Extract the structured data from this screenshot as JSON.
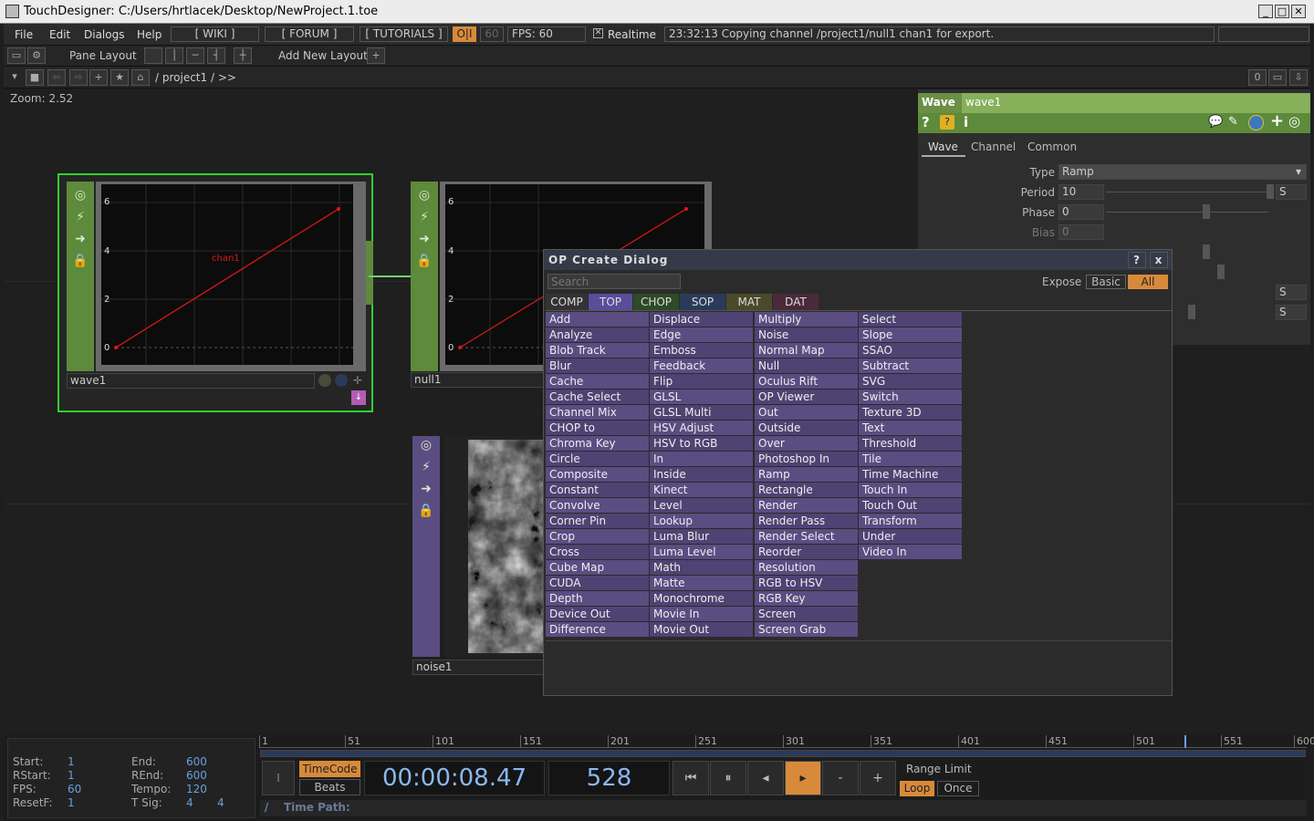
{
  "window": {
    "title": "TouchDesigner: C:/Users/hrtlacek/Desktop/NewProject.1.toe"
  },
  "menu": {
    "file": "File",
    "edit": "Edit",
    "dialogs": "Dialogs",
    "help": "Help",
    "wiki": "[ WIKI ]",
    "forum": "[ FORUM ]",
    "tutorials": "[ TUTORIALS ]",
    "oi": "O|I",
    "fps_cap": "60",
    "fps": "FPS:  60",
    "realtime": "Realtime",
    "status": "23:32:13 Copying channel /project1/null1 chan1 for export."
  },
  "toolbar": {
    "pane_layout": "Pane Layout",
    "add_layout": "Add New Layout",
    "path": "/ project1 / >>",
    "zero": "0"
  },
  "network": {
    "zoom": "Zoom: 2.52",
    "wave": {
      "name": "wave1",
      "chan": "chan1",
      "ticks": [
        "6",
        "4",
        "2",
        "0"
      ]
    },
    "null": {
      "name": "null1",
      "ticks": [
        "6",
        "4",
        "2",
        "0"
      ]
    },
    "noise": {
      "name": "noise1"
    }
  },
  "params": {
    "op_type": "Wave",
    "op_name": "wave1",
    "tabs": [
      "Wave",
      "Channel",
      "Common"
    ],
    "type_label": "Type",
    "type_value": "Ramp",
    "period_label": "Period",
    "period_value": "10",
    "phase_label": "Phase",
    "phase_value": "0",
    "bias_label": "Bias",
    "bias_value": "0",
    "s": "S"
  },
  "dialog": {
    "title": "OP Create Dialog",
    "help": "?",
    "close": "x",
    "search_placeholder": "Search",
    "expose": "Expose",
    "basic": "Basic",
    "all": "All",
    "families": [
      "COMP",
      "TOP",
      "CHOP",
      "SOP",
      "MAT",
      "DAT"
    ],
    "col1": [
      "Add",
      "Analyze",
      "Blob Track",
      "Blur",
      "Cache",
      "Cache Select",
      "Channel Mix",
      "CHOP to",
      "Chroma Key",
      "Circle",
      "Composite",
      "Constant",
      "Convolve",
      "Corner Pin",
      "Crop",
      "Cross",
      "Cube Map",
      "CUDA",
      "Depth",
      "Device Out",
      "Difference"
    ],
    "col2": [
      "Displace",
      "Edge",
      "Emboss",
      "Feedback",
      "Flip",
      "GLSL",
      "GLSL Multi",
      "HSV Adjust",
      "HSV to RGB",
      "In",
      "Inside",
      "Kinect",
      "Level",
      "Lookup",
      "Luma Blur",
      "Luma Level",
      "Math",
      "Matte",
      "Monochrome",
      "Movie In",
      "Movie Out"
    ],
    "col3": [
      "Multiply",
      "Noise",
      "Normal Map",
      "Null",
      "Oculus Rift",
      "OP Viewer",
      "Out",
      "Outside",
      "Over",
      "Photoshop In",
      "Ramp",
      "Rectangle",
      "Render",
      "Render Pass",
      "Render Select",
      "Reorder",
      "Resolution",
      "RGB to HSV",
      "RGB Key",
      "Screen",
      "Screen Grab"
    ],
    "col4": [
      "Select",
      "Slope",
      "SSAO",
      "Subtract",
      "SVG",
      "Switch",
      "Texture 3D",
      "Text",
      "Threshold",
      "Tile",
      "Time Machine",
      "Touch In",
      "Touch Out",
      "Transform",
      "Under",
      "Video In"
    ]
  },
  "timeline": {
    "ticks": [
      "1",
      "51",
      "101",
      "151",
      "201",
      "251",
      "301",
      "351",
      "401",
      "451",
      "501",
      "551",
      "600"
    ],
    "start_label": "Start:",
    "start": "1",
    "end_label": "End:",
    "end": "600",
    "rstart_label": "RStart:",
    "rstart": "1",
    "rend_label": "REnd:",
    "rend": "600",
    "fps_label": "FPS:",
    "fps": "60",
    "tempo_label": "Tempo:",
    "tempo": "120",
    "resetf_label": "ResetF:",
    "resetf": "1",
    "tsig_label": "T Sig:",
    "tsig_a": "4",
    "tsig_b": "4",
    "timecode": "TimeCode",
    "beats": "Beats",
    "time": "00:00:08.47",
    "frame": "528",
    "range_limit": "Range Limit",
    "loop": "Loop",
    "once": "Once",
    "time_path": "Time Path:",
    "slash": "/",
    "cursor": "I",
    "minus": "-",
    "plus": "+"
  }
}
